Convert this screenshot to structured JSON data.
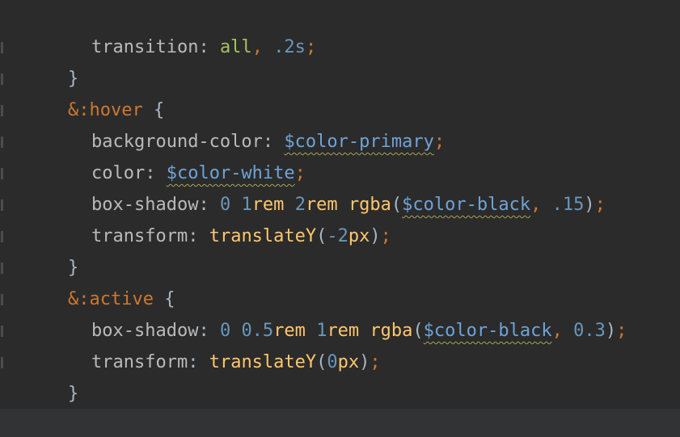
{
  "editor": {
    "lines": [
      {
        "tokens": [
          {
            "t": "prop",
            "v": "transition"
          },
          {
            "t": "cc",
            "v": ": "
          },
          {
            "t": "kw",
            "v": "all"
          },
          {
            "t": "punc",
            "v": ", "
          },
          {
            "t": "num",
            "v": ".2s"
          },
          {
            "t": "punc",
            "v": ";"
          }
        ]
      },
      {
        "tokens": [
          {
            "t": "brace",
            "v": "}"
          }
        ]
      },
      {
        "tokens": [
          {
            "t": "sel",
            "v": "&:"
          },
          {
            "t": "sel",
            "v": "hover"
          },
          {
            "t": "brace",
            "v": " {"
          }
        ]
      },
      {
        "tokens": [
          {
            "t": "prop",
            "v": "background-color"
          },
          {
            "t": "cc",
            "v": ": "
          },
          {
            "t": "var",
            "v": "$color-primary"
          },
          {
            "t": "punc",
            "v": ";"
          }
        ]
      },
      {
        "tokens": [
          {
            "t": "prop",
            "v": "color"
          },
          {
            "t": "cc",
            "v": ": "
          },
          {
            "t": "var",
            "v": "$color-white"
          },
          {
            "t": "punc",
            "v": ";"
          }
        ]
      },
      {
        "tokens": [
          {
            "t": "prop",
            "v": "box-shadow"
          },
          {
            "t": "cc",
            "v": ": "
          },
          {
            "t": "num",
            "v": "0"
          },
          {
            "t": "cc",
            "v": " "
          },
          {
            "t": "num",
            "v": "1"
          },
          {
            "t": "fn",
            "v": "rem"
          },
          {
            "t": "cc",
            "v": " "
          },
          {
            "t": "num",
            "v": "2"
          },
          {
            "t": "fn",
            "v": "rem"
          },
          {
            "t": "cc",
            "v": " "
          },
          {
            "t": "fn",
            "v": "rgba"
          },
          {
            "t": "cc",
            "v": "("
          },
          {
            "t": "var",
            "v": "$color-black"
          },
          {
            "t": "punc",
            "v": ", "
          },
          {
            "t": "num",
            "v": ".15"
          },
          {
            "t": "cc",
            "v": ")"
          },
          {
            "t": "punc",
            "v": ";"
          }
        ]
      },
      {
        "tokens": [
          {
            "t": "prop",
            "v": "transform"
          },
          {
            "t": "cc",
            "v": ": "
          },
          {
            "t": "fn",
            "v": "translateY"
          },
          {
            "t": "cc",
            "v": "("
          },
          {
            "t": "num",
            "v": "-2"
          },
          {
            "t": "fn",
            "v": "px"
          },
          {
            "t": "cc",
            "v": ")"
          },
          {
            "t": "punc",
            "v": ";"
          }
        ]
      },
      {
        "tokens": [
          {
            "t": "brace",
            "v": "}"
          }
        ]
      },
      {
        "tokens": [
          {
            "t": "sel",
            "v": "&:"
          },
          {
            "t": "sel",
            "v": "active"
          },
          {
            "t": "brace",
            "v": " {"
          }
        ]
      },
      {
        "tokens": [
          {
            "t": "prop",
            "v": "box-shadow"
          },
          {
            "t": "cc",
            "v": ": "
          },
          {
            "t": "num",
            "v": "0"
          },
          {
            "t": "cc",
            "v": " "
          },
          {
            "t": "num",
            "v": "0.5"
          },
          {
            "t": "fn",
            "v": "rem"
          },
          {
            "t": "cc",
            "v": " "
          },
          {
            "t": "num",
            "v": "1"
          },
          {
            "t": "fn",
            "v": "rem"
          },
          {
            "t": "cc",
            "v": " "
          },
          {
            "t": "fn",
            "v": "rgba"
          },
          {
            "t": "cc",
            "v": "("
          },
          {
            "t": "var",
            "v": "$color-black"
          },
          {
            "t": "punc",
            "v": ", "
          },
          {
            "t": "num",
            "v": "0.3"
          },
          {
            "t": "cc",
            "v": ")"
          },
          {
            "t": "punc",
            "v": ";"
          }
        ]
      },
      {
        "tokens": [
          {
            "t": "prop",
            "v": "transform"
          },
          {
            "t": "cc",
            "v": ": "
          },
          {
            "t": "fn",
            "v": "translateY"
          },
          {
            "t": "cc",
            "v": "("
          },
          {
            "t": "num",
            "v": "0"
          },
          {
            "t": "fn",
            "v": "px"
          },
          {
            "t": "cc",
            "v": ")"
          },
          {
            "t": "punc",
            "v": ";"
          }
        ]
      },
      {
        "tokens": [
          {
            "t": "brace",
            "v": "}"
          }
        ]
      },
      {
        "tokens": [
          {
            "t": "brace",
            "v": "}"
          }
        ]
      }
    ]
  },
  "colors": {
    "background": "#2b2b2b",
    "footer": "#313335",
    "selector": "#cc7832",
    "property": "#bababa",
    "keyword": "#a5c261",
    "number": "#6897bb",
    "variable": "#6fa3d6",
    "function": "#ffc66d",
    "warning_underline": "#a5a55a"
  }
}
